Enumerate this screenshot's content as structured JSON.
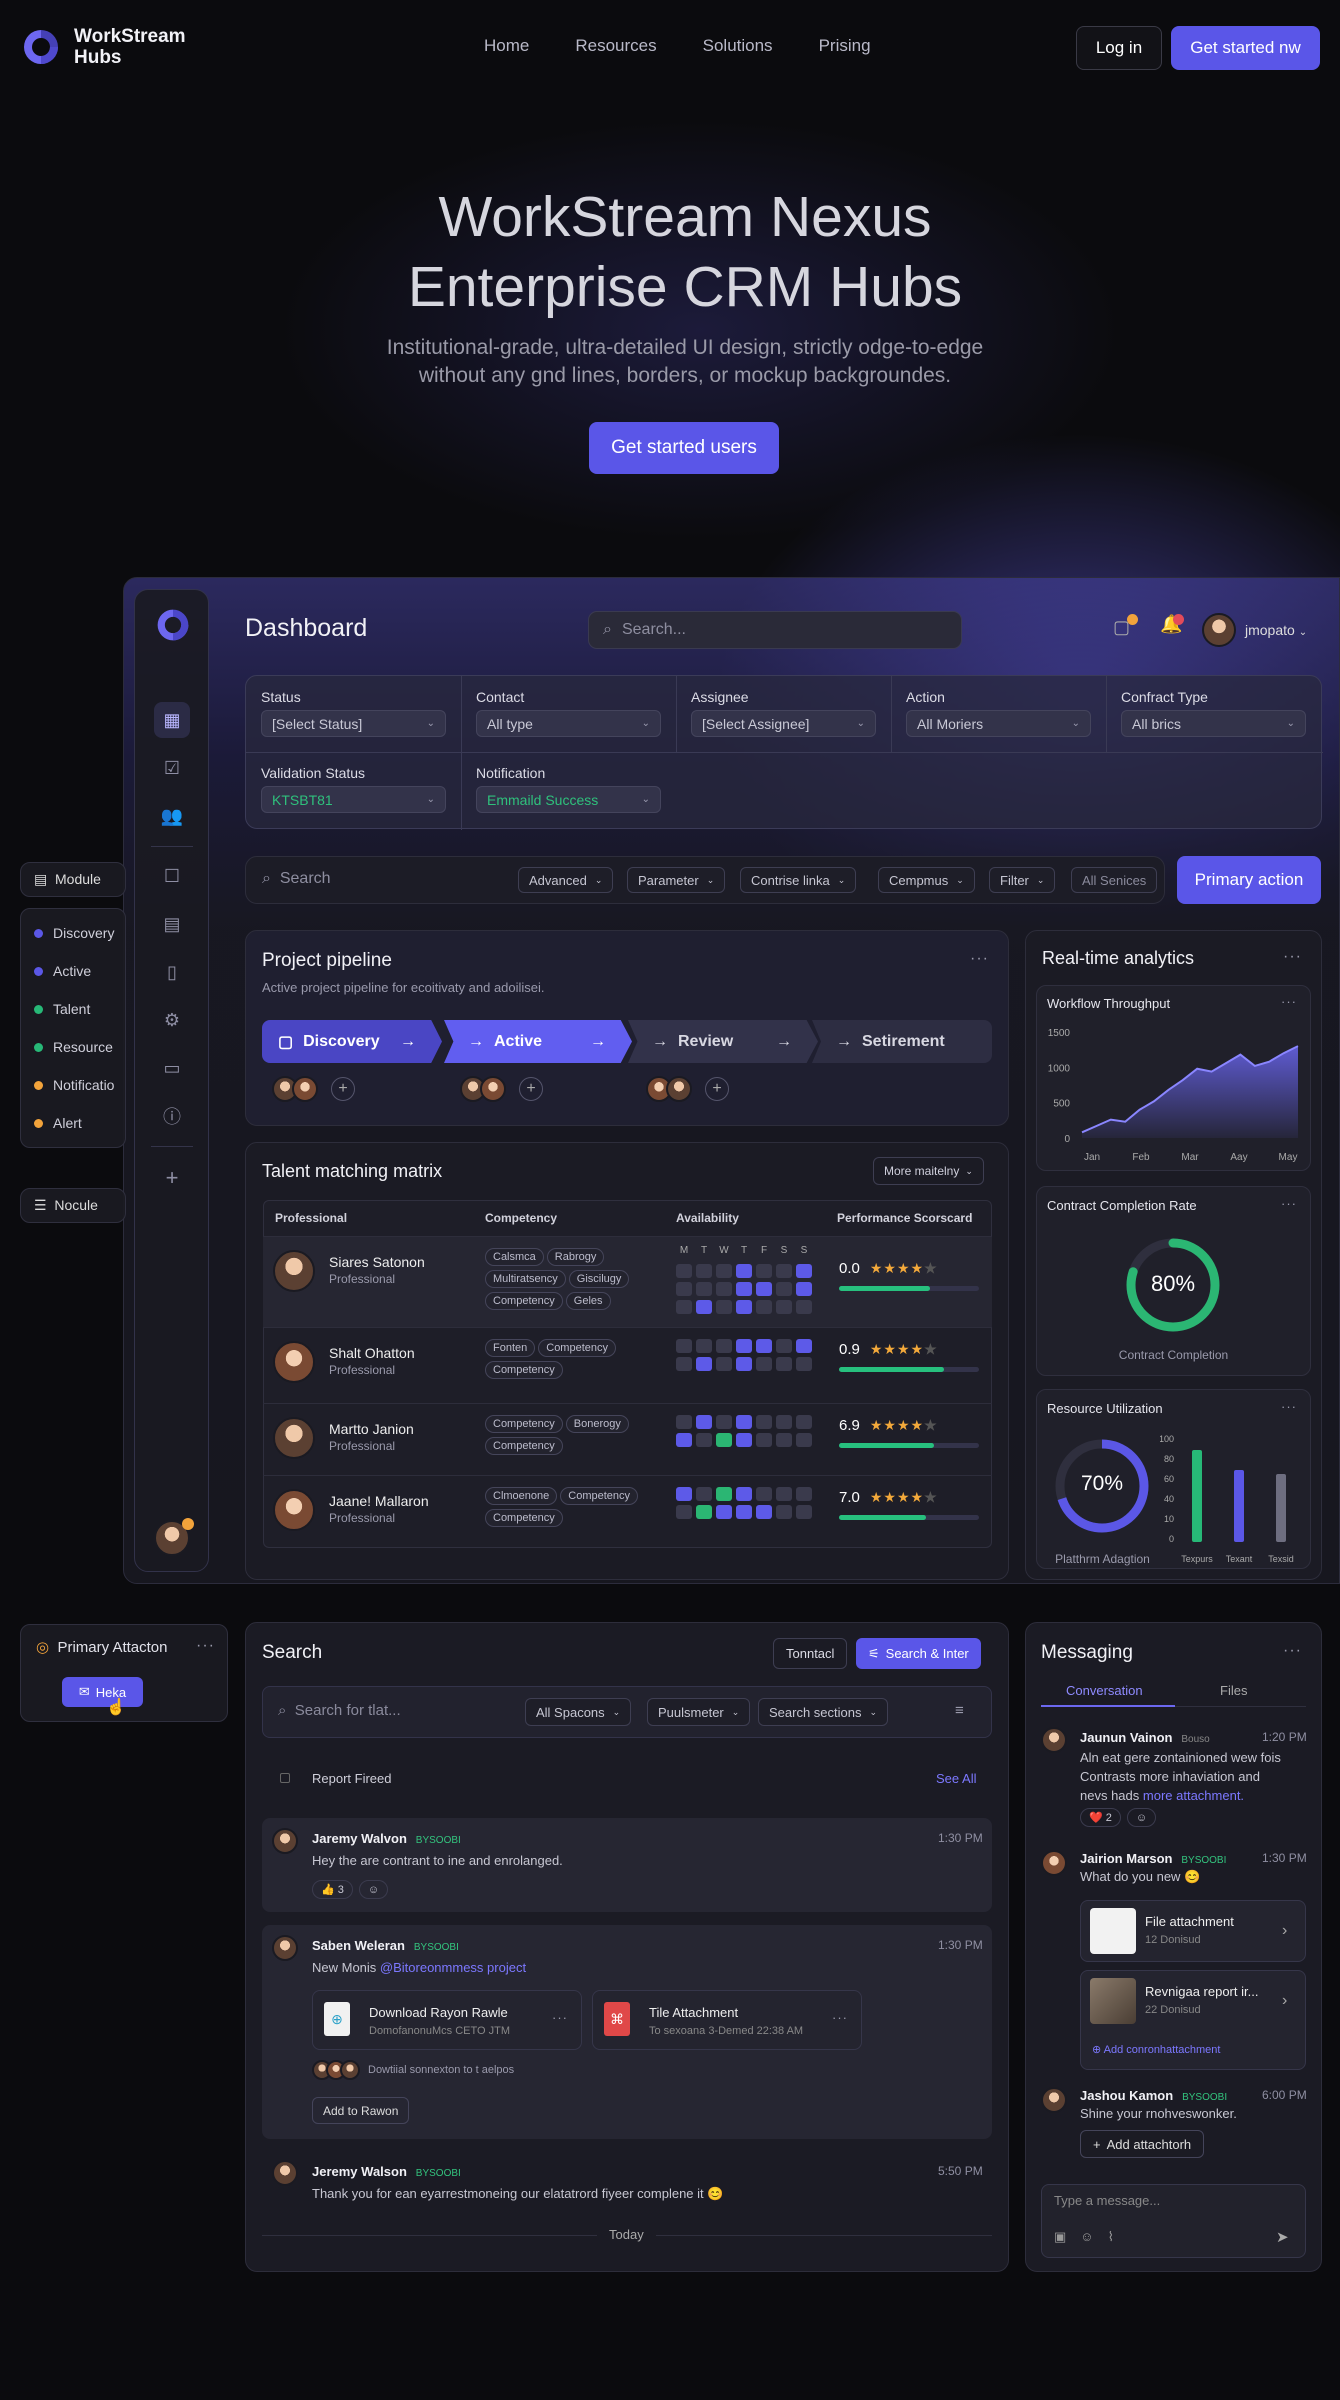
{
  "brand": {
    "name": "WorkStream Hubs"
  },
  "nav": {
    "items": [
      "Home",
      "Resources",
      "Solutions",
      "Prising"
    ],
    "login": "Log in",
    "cta": "Get started nw"
  },
  "hero": {
    "title_line1": "WorkStream Nexus",
    "title_line2": "Enterprise CRM Hubs",
    "sub_line1": "Institutional-grade, ultra-detailed UI design, strictly odge-to-edge",
    "sub_line2": "without any gnd lines, borders, or mockup backgroundes.",
    "cta": "Get started users"
  },
  "dashboard": {
    "title": "Dashboard",
    "search_placeholder": "Search...",
    "user": "jmopato",
    "filters": [
      {
        "label": "Status",
        "value": "[Select Status]"
      },
      {
        "label": "Contact",
        "value": "All type"
      },
      {
        "label": "Assignee",
        "value": "[Select Assignee]"
      },
      {
        "label": "Action",
        "value": "All Moriers"
      },
      {
        "label": "Confract Type",
        "value": "All brics"
      },
      {
        "label": "Validation Status",
        "value": "KTSBT81"
      },
      {
        "label": "Notification",
        "value": "Emmaild Success"
      }
    ],
    "searchbar": {
      "placeholder": "Search",
      "chips": [
        "Advanced",
        "Parameter",
        "Contrise linka",
        "Cempmus",
        "Filter",
        "All Senices"
      ],
      "primary": "Primary action"
    }
  },
  "left_widgets": {
    "module": "Module",
    "items": [
      {
        "label": "Discovery",
        "color": "#5b57e6"
      },
      {
        "label": "Active",
        "color": "#5b57e6"
      },
      {
        "label": "Talent",
        "color": "#27b877"
      },
      {
        "label": "Resource",
        "color": "#27b877"
      },
      {
        "label": "Notificatio",
        "color": "#f2a33b"
      },
      {
        "label": "Alert",
        "color": "#f2a33b"
      }
    ],
    "nocule": "Nocule",
    "primary_title": "Primary Attacton",
    "primary_btn": "Heka"
  },
  "pipeline": {
    "title": "Project pipeline",
    "subtitle": "Active project pipeline for ecoitivaty and adoilisei.",
    "stages": [
      "Discovery",
      "Active",
      "Review",
      "Setirement"
    ]
  },
  "talent": {
    "title": "Talent matching matrix",
    "more": "More maitelny",
    "headers": [
      "Professional",
      "Competency",
      "Availability",
      "Performance Scorscard"
    ],
    "days": [
      "M",
      "T",
      "W",
      "T",
      "F",
      "S",
      "S"
    ],
    "rows": [
      {
        "name": "Siares Satonon",
        "role": "Professional",
        "tags": [
          "Calsmca",
          "Rabrogy",
          "Multiratsency",
          "Giscilugy",
          "Competency",
          "Geles"
        ],
        "score": "0.0",
        "pct": 0.65
      },
      {
        "name": "Shalt Ohatton",
        "role": "Professional",
        "tags": [
          "Fonten",
          "Competency",
          "Competency"
        ],
        "score": "0.9",
        "pct": 0.75
      },
      {
        "name": "Martto Janion",
        "role": "Professional",
        "tags": [
          "Competency",
          "Bonerogy",
          "Competency"
        ],
        "score": "6.9",
        "pct": 0.68
      },
      {
        "name": "Jaane! Mallaron",
        "role": "Professional",
        "tags": [
          "Clmoenone",
          "Competency",
          "Competency"
        ],
        "score": "7.0",
        "pct": 0.62
      }
    ]
  },
  "analytics": {
    "title": "Real-time analytics",
    "workflow": "Workflow Throughput",
    "chart_data": {
      "type": "area",
      "title": "Workflow Throughput",
      "x": [
        "Jan",
        "Feb",
        "Mar",
        "Aay",
        "May"
      ],
      "yticks": [
        0,
        500,
        1000,
        1500
      ],
      "ylim": [
        0,
        1500
      ],
      "series": [
        {
          "values": [
            80,
            170,
            260,
            230,
            400,
            520,
            680,
            820,
            980,
            940,
            1060,
            1180,
            1020,
            1080,
            1200,
            1300
          ]
        }
      ]
    },
    "contract": {
      "title": "Contract Completion Rate",
      "value": "80%",
      "pct": 0.8,
      "caption": "Contract Completion"
    },
    "resource": {
      "title": "Resource Utilization",
      "value": "70%",
      "pct": 0.7,
      "caption": "Platthrm Adagtion",
      "yticks": [
        "100",
        "80",
        "60",
        "40",
        "10",
        "0"
      ],
      "bars": [
        {
          "label": "Texpurs",
          "value": 92,
          "color": "#27b877"
        },
        {
          "label": "Texant",
          "value": 72,
          "color": "#5b57e6"
        },
        {
          "label": "Texsid",
          "value": 68,
          "color": "#6e6e80"
        }
      ]
    }
  },
  "search": {
    "title": "Search",
    "contact_btn": "Tonntacl",
    "search_btn": "Search & Inter",
    "placeholder": "Search for tlat...",
    "chips": [
      "All Spacons",
      "Puulsmeter",
      "Search sections"
    ],
    "report": "Report Fireed",
    "see_all": "See All",
    "msgs": [
      {
        "name": "Jaremy Walvon",
        "badge": "BYSOOBI",
        "time": "1:30 PM",
        "text": "Hey the are contrant to ine and enrolanged.",
        "react": "👍 3"
      },
      {
        "name": "Saben Weleran",
        "badge": "BYSOOBI",
        "time": "1:30 PM",
        "text": "New Monis",
        "mention": "@Bitoreonmmess project",
        "file1": "Download Rayon Rawle",
        "file1sub": "DomofanonuMcs CETO JTM",
        "file2": "Tile Attachment",
        "file2sub": "To sexoana 3-Demed 22:38 AM",
        "note": "Dowtiial sonnexton to t aelpos",
        "btn": "Add to Rawon"
      },
      {
        "name": "Jeremy Walson",
        "badge": "BYSOOBI",
        "time": "5:50 PM",
        "text": "Thank you for ean eyarrestmoneing our elatatrord fiyeer complene it 😊"
      }
    ],
    "today": "Today"
  },
  "messaging": {
    "title": "Messaging",
    "tabs": [
      "Conversation",
      "Files"
    ],
    "msgs": [
      {
        "name": "Jaunun Vainon",
        "badge": "Bouso",
        "time": "1:20 PM",
        "text1": "Aln eat gere zontainioned wew fois",
        "text2": "Contrasts more inhaviation and",
        "text3": "nevs hads",
        "link": "more attachment.",
        "react": "❤️ 2"
      },
      {
        "name": "Jairion Marson",
        "badge": "BYSOOBI",
        "time": "1:30 PM",
        "text": "What do you new 😊",
        "att1": "File attachment",
        "att1sub": "12 Donisud",
        "att2": "Revnigaa report ir...",
        "att2sub": "22 Donisud",
        "add": "Add conronhattachment"
      },
      {
        "name": "Jashou Kamon",
        "badge": "BYSOOBI",
        "time": "6:00 PM",
        "text": "Shine your rnohveswonker.",
        "btn": "Add attachtorh"
      }
    ],
    "placeholder": "Type a message..."
  }
}
